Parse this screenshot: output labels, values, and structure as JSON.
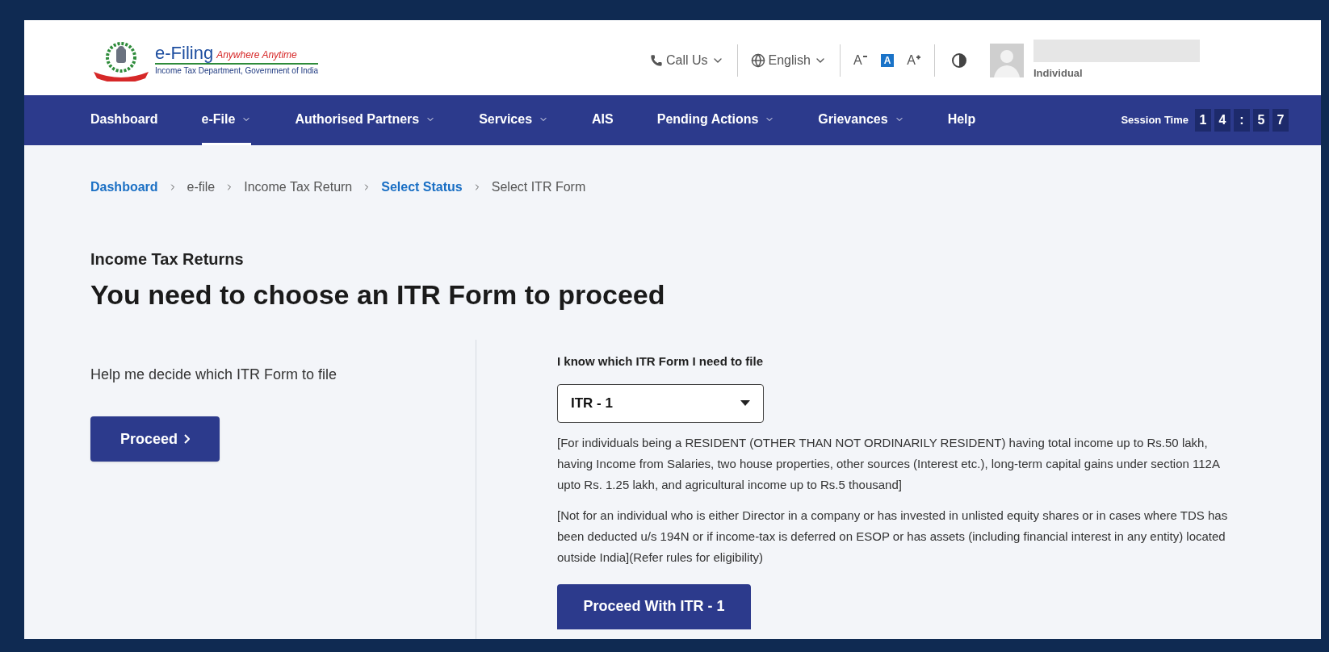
{
  "header": {
    "logo": {
      "title": "e-Filing",
      "tagline": "Anywhere Anytime",
      "subtitle": "Income Tax Department, Government of India"
    },
    "call_us": "Call Us",
    "language": "English",
    "text_size": [
      {
        "label": "A",
        "kind": "decrease",
        "selected": false
      },
      {
        "label": "A",
        "kind": "normal",
        "selected": true
      },
      {
        "label": "A",
        "kind": "increase",
        "selected": false
      }
    ],
    "user": {
      "role": "Individual"
    }
  },
  "nav": {
    "items": [
      {
        "label": "Dashboard",
        "dropdown": false,
        "selected": false
      },
      {
        "label": "e-File",
        "dropdown": true,
        "selected": true
      },
      {
        "label": "Authorised Partners",
        "dropdown": true,
        "selected": false
      },
      {
        "label": "Services",
        "dropdown": true,
        "selected": false
      },
      {
        "label": "AIS",
        "dropdown": false,
        "selected": false
      },
      {
        "label": "Pending Actions",
        "dropdown": true,
        "selected": false
      },
      {
        "label": "Grievances",
        "dropdown": true,
        "selected": false
      },
      {
        "label": "Help",
        "dropdown": false,
        "selected": false
      }
    ],
    "session": {
      "label": "Session Time",
      "digits": [
        "1",
        "4",
        ":",
        "5",
        "7"
      ]
    }
  },
  "breadcrumb": [
    {
      "label": "Dashboard",
      "link": true
    },
    {
      "label": "e-file",
      "link": false
    },
    {
      "label": "Income Tax Return",
      "link": false
    },
    {
      "label": "Select Status",
      "link": true
    },
    {
      "label": "Select ITR Form",
      "link": false
    }
  ],
  "page": {
    "kicker": "Income Tax Returns",
    "title": "You need to choose an ITR Form to proceed"
  },
  "left": {
    "text": "Help me decide which ITR Form to file",
    "button": "Proceed"
  },
  "right": {
    "label": "I know which ITR Form I need to file",
    "select_value": "ITR - 1",
    "paragraphs": [
      "[For individuals being a RESIDENT (OTHER THAN NOT ORDINARILY RESIDENT) having total income up to Rs.50 lakh, having Income from Salaries, two house properties, other sources (Interest etc.), long-term capital gains under section 112A upto Rs. 1.25 lakh, and agricultural income up to Rs.5 thousand]",
      "[Not for an individual who is either Director in a company or has invested in unlisted equity shares or in cases where TDS has been deducted u/s 194N or if income-tax is deferred on ESOP or has assets (including financial interest in any entity) located outside India](Refer rules for eligibility)"
    ],
    "button": "Proceed With ITR - 1"
  }
}
